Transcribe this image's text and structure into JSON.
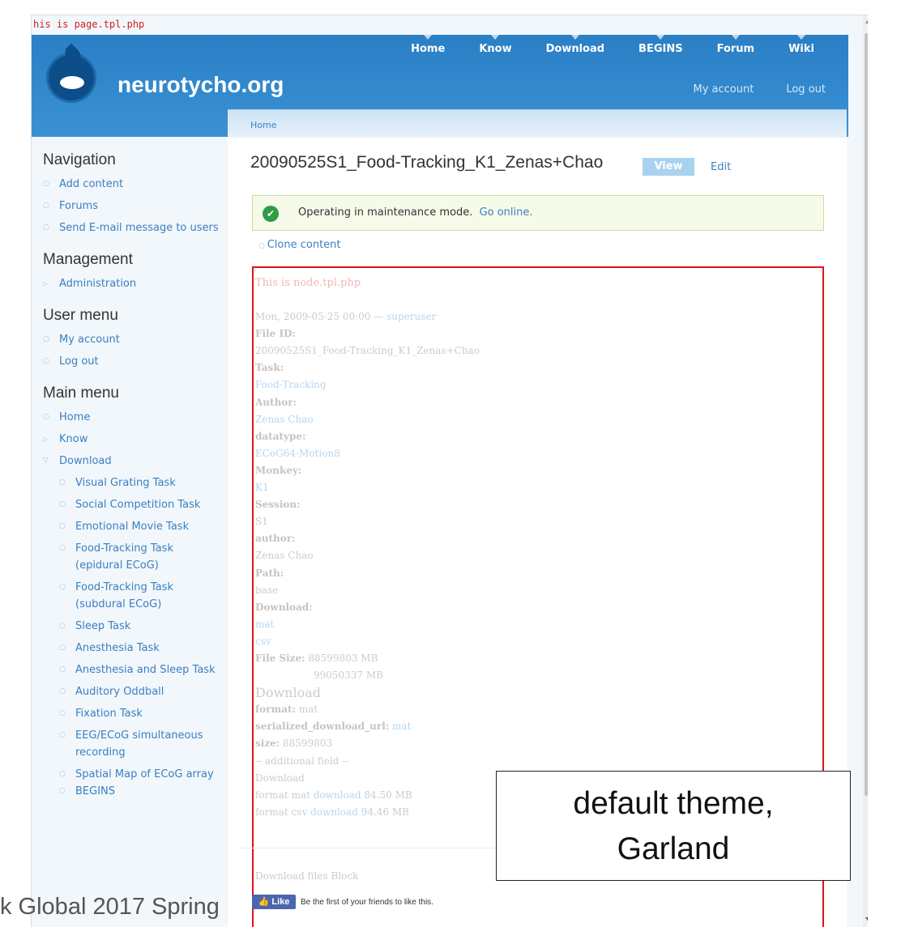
{
  "template_note": "his is page.tpl.php",
  "site_name": "neurotycho.org",
  "primary_links": [
    "Home",
    "Know",
    "Download",
    "BEGINS",
    "Forum",
    "Wiki"
  ],
  "secondary_links": [
    "My account",
    "Log out"
  ],
  "breadcrumb": "Home",
  "sidebar": {
    "navigation": {
      "title": "Navigation",
      "items": [
        "Add content",
        "Forums",
        "Send E-mail message to users"
      ]
    },
    "management": {
      "title": "Management",
      "items": [
        "Administration"
      ]
    },
    "user_menu": {
      "title": "User menu",
      "items": [
        "My account",
        "Log out"
      ]
    },
    "main_menu": {
      "title": "Main menu",
      "items": [
        "Home",
        "Know",
        "Download"
      ],
      "download_children": [
        "Visual Grating Task",
        "Social Competition Task",
        "Emotional Movie Task",
        "Food-Tracking Task (epidural ECoG)",
        "Food-Tracking Task (subdural ECoG)",
        "Sleep Task",
        "Anesthesia Task",
        "Anesthesia and Sleep Task",
        "Auditory Oddball",
        "Fixation Task",
        "EEG/ECoG simultaneous recording",
        "Spatial Map of ECoG array",
        "BEGINS"
      ]
    }
  },
  "page": {
    "title": "20090525S1_Food-Tracking_K1_Zenas+Chao",
    "tab_view": "View",
    "tab_edit": "Edit",
    "status_message": "Operating in maintenance mode.",
    "status_link": "Go online.",
    "clone_link": "Clone content"
  },
  "node": {
    "template_note": "This is node.tpl.php",
    "submitted_date": "Mon, 2009-05-25 00:00",
    "submitted_sep": "—",
    "submitted_user": "superuser",
    "file_id_label": "File ID:",
    "file_id": "20090525S1_Food-Tracking_K1_Zenas+Chao",
    "task_label": "Task:",
    "task": "Food-Tracking",
    "author_label": "Author:",
    "author": "Zenas Chao",
    "datatype_label": "datatype:",
    "datatype": "ECoG64-Motion8",
    "monkey_label": "Monkey:",
    "monkey": "K1",
    "session_label": "Session:",
    "session": "S1",
    "author2_label": "author:",
    "author2": "Zenas Chao",
    "path_label": "Path:",
    "path": "base",
    "download_label": "Download:",
    "download_mat": "mat",
    "download_csv": "csv",
    "file_size_label": "File Size:",
    "file_size_1": "88599803 MB",
    "file_size_2": "99050337 MB",
    "download_heading": "Download",
    "format_label": "format:",
    "format_value": "mat",
    "serialized_label": "serialized_download_url:",
    "serialized_value": "mat",
    "size_label": "size:",
    "size_value": "88599803",
    "additional_field": "-- additional field --",
    "download_line": "Download",
    "format_mat_prefix": "format mat",
    "format_mat_link": "download",
    "format_mat_size": "84.50 MB",
    "format_csv_prefix": "format csv",
    "format_csv_link": "download",
    "format_csv_size": "94.46 MB",
    "download_files_block": "Download files Block"
  },
  "like": {
    "button": "Like",
    "text": "Be the first of your friends to like this."
  },
  "caption": {
    "line1": "default theme,",
    "line2": "Garland"
  },
  "footer_text": "k Global 2017 Spring"
}
